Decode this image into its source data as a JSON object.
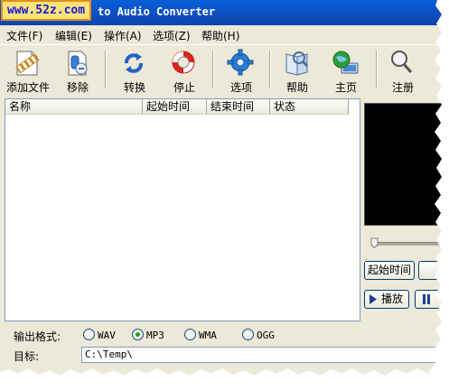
{
  "window": {
    "badge": "www.52z.com",
    "title": "to Audio Converter"
  },
  "menu": [
    "文件(F)",
    "编辑(E)",
    "操作(A)",
    "选项(Z)",
    "帮助(H)"
  ],
  "toolbar": {
    "add_file": "添加文件",
    "remove": "移除",
    "convert": "转换",
    "stop": "停止",
    "options": "选项",
    "help": "帮助",
    "home": "主页",
    "register": "注册"
  },
  "list": {
    "columns": [
      "名称",
      "起始时间",
      "结束时间",
      "状态"
    ]
  },
  "player": {
    "start_time_button": "起始时间",
    "play_button": "播放"
  },
  "output": {
    "format_label": "输出格式:",
    "formats": [
      "WAV",
      "MP3",
      "WMA",
      "OGG"
    ],
    "selected": "MP3",
    "target_label": "目标:",
    "target_value": "C:\\Temp\\"
  },
  "colors": {
    "titlebar": "#0c4fc0",
    "badge_bg": "#f7e27c",
    "badge_border": "#e08f10",
    "window_bg": "#ece9d8"
  }
}
